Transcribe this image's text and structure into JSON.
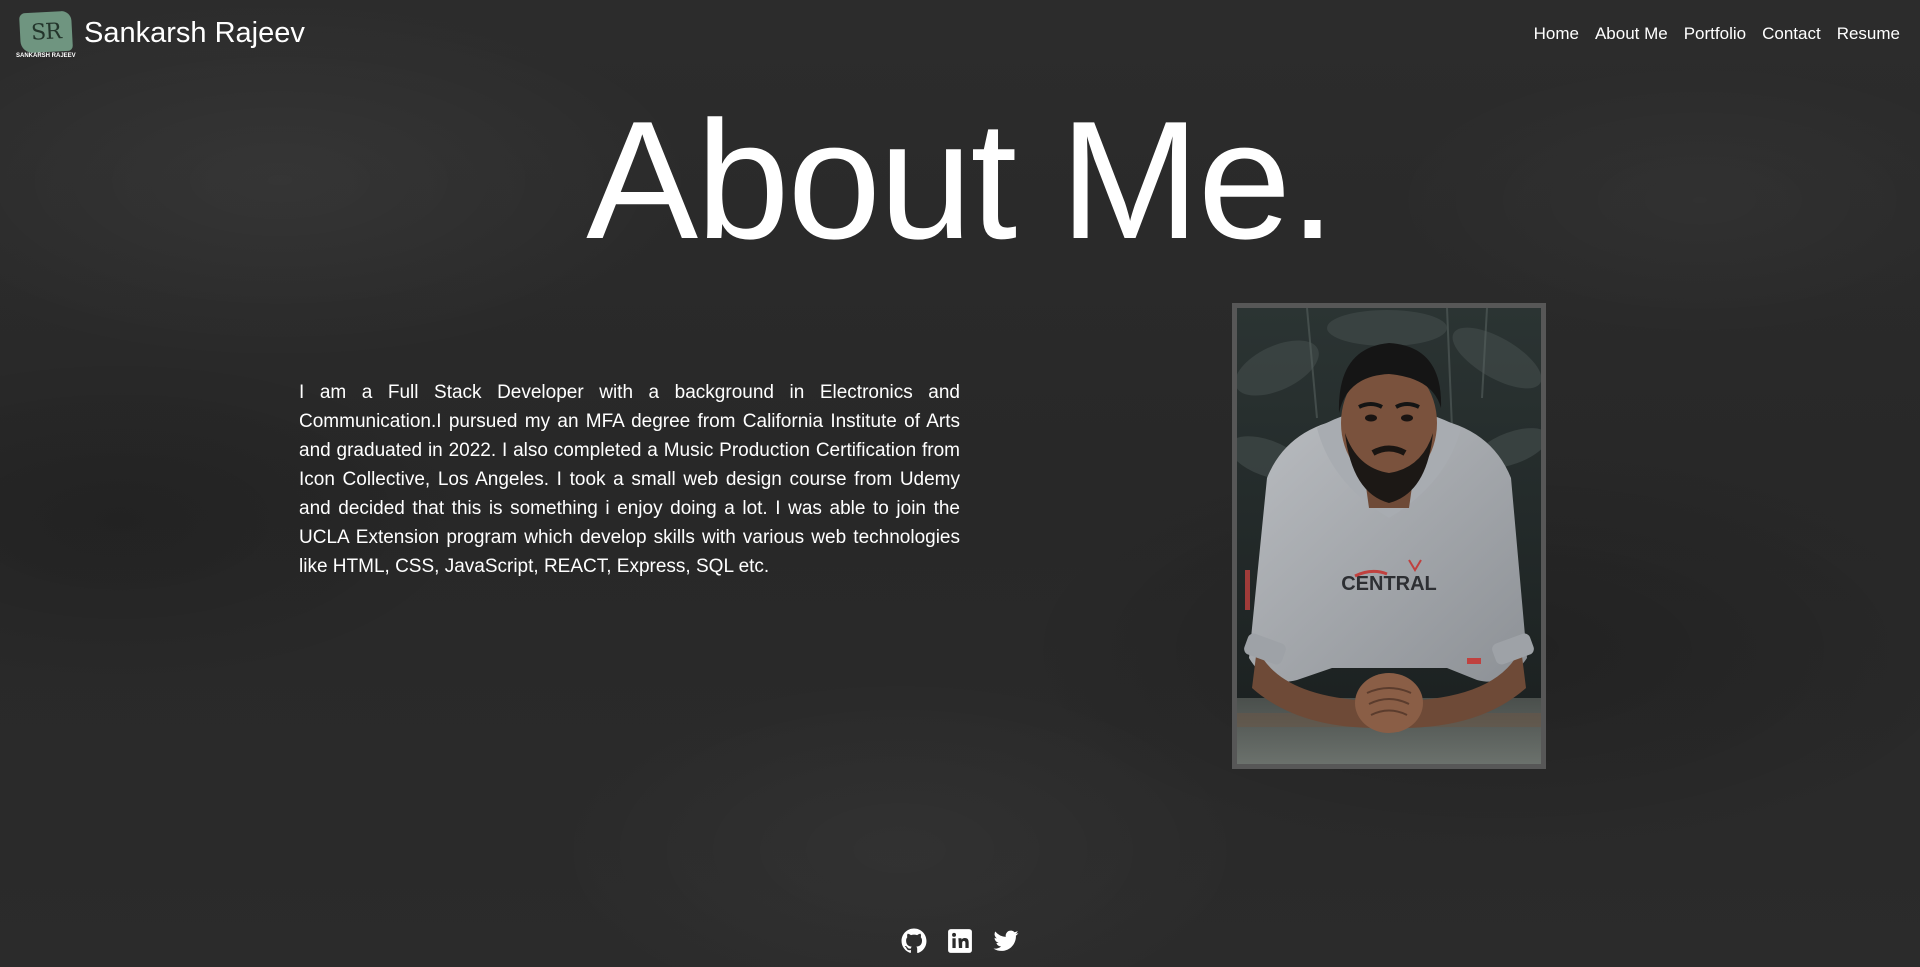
{
  "header": {
    "logo": {
      "initials": "SR",
      "caption": "SANKARSH RAJEEV",
      "color": "#6f9580"
    },
    "brand_name": "Sankarsh Rajeev",
    "nav": [
      {
        "label": "Home"
      },
      {
        "label": "About Me"
      },
      {
        "label": "Portfolio"
      },
      {
        "label": "Contact"
      },
      {
        "label": "Resume"
      }
    ]
  },
  "main": {
    "title": "About Me.",
    "bio": "I am a Full Stack Developer with a background in Electronics and Communication.I pursued my an MFA degree from California Institute of Arts and graduated in 2022. I also completed a Music Production Certification from Icon Collective, Los Angeles. I took a small web design course from Udemy and decided that this is something i enjoy doing a lot. I was able to join the UCLA Extension program which develop skills with various web technologies like HTML, CSS, JavaScript, REACT, Express, SQL etc.",
    "photo": {
      "hoodie_text": "CENTRAL"
    }
  },
  "footer": {
    "socials": [
      {
        "icon": "github-icon"
      },
      {
        "icon": "linkedin-icon"
      },
      {
        "icon": "twitter-icon"
      }
    ]
  },
  "colors": {
    "background": "#2a2a2a",
    "text": "#ffffff",
    "photo_border": "#575757"
  }
}
